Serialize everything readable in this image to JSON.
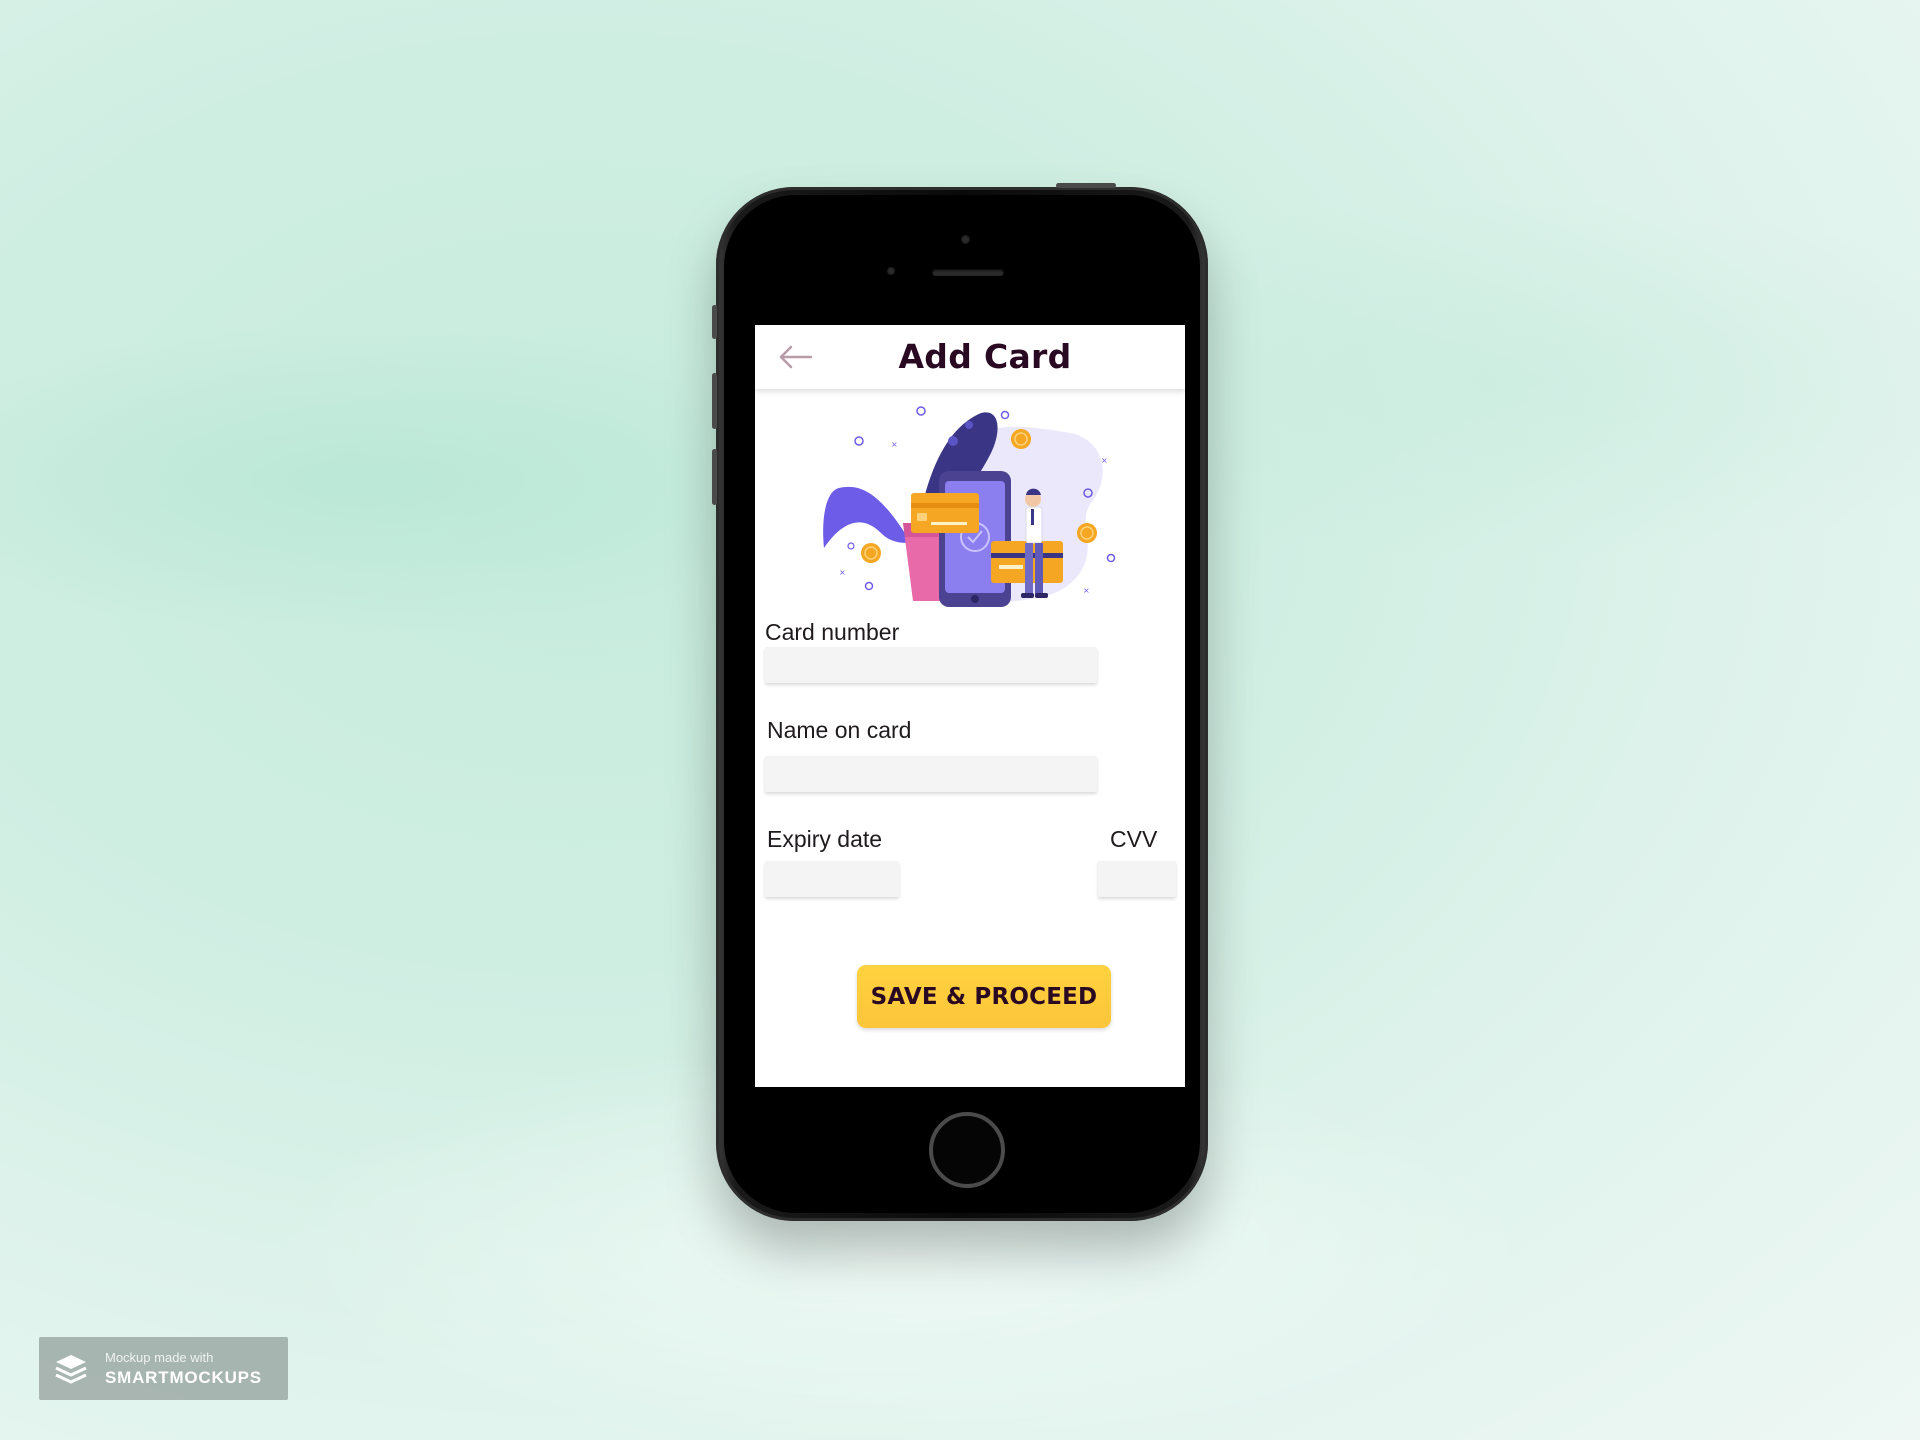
{
  "screen": {
    "header": {
      "title": "Add Card",
      "back_icon": "arrow-left-icon"
    },
    "illustration": "credit-card-payment-illustration",
    "form": {
      "card_number_label": "Card number",
      "card_number_value": "",
      "name_label": "Name on card",
      "name_value": "",
      "expiry_label": "Expiry date",
      "expiry_value": "",
      "cvv_label": "CVV",
      "cvv_value": ""
    },
    "save_button_label": "SAVE & PROCEED"
  },
  "watermark": {
    "line1": "Mockup made with",
    "line2": "SMARTMOCKUPS",
    "icon": "layers-icon"
  },
  "colors": {
    "accent_button": "#fcc53a",
    "title_text": "#2a0a22",
    "background": "#cfeee2",
    "illustration_purple": "#6c5ce7",
    "illustration_orange": "#f5a623"
  }
}
